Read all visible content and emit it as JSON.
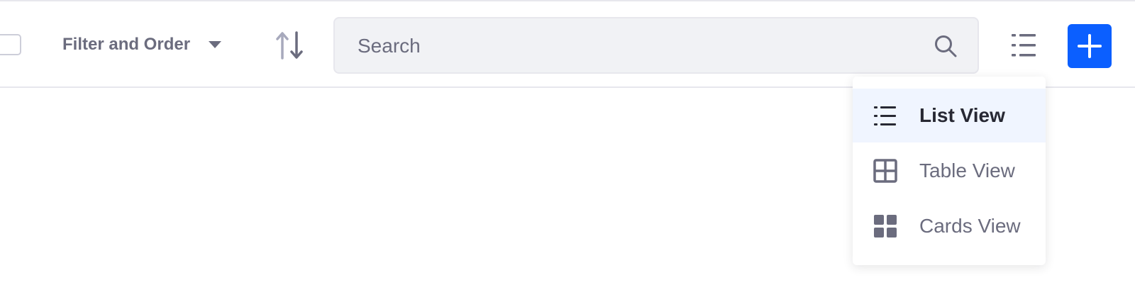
{
  "toolbar": {
    "filter_label": "Filter and Order",
    "search_placeholder": "Search"
  },
  "view_menu": {
    "items": [
      {
        "label": "List View",
        "icon": "list-icon",
        "active": true
      },
      {
        "label": "Table View",
        "icon": "table-icon",
        "active": false
      },
      {
        "label": "Cards View",
        "icon": "cards-icon",
        "active": false
      }
    ]
  },
  "colors": {
    "primary": "#0b5fff",
    "text_secondary": "#6b6c7e",
    "text_primary": "#272833",
    "active_bg": "#f0f5ff",
    "search_bg": "#f1f2f5"
  }
}
